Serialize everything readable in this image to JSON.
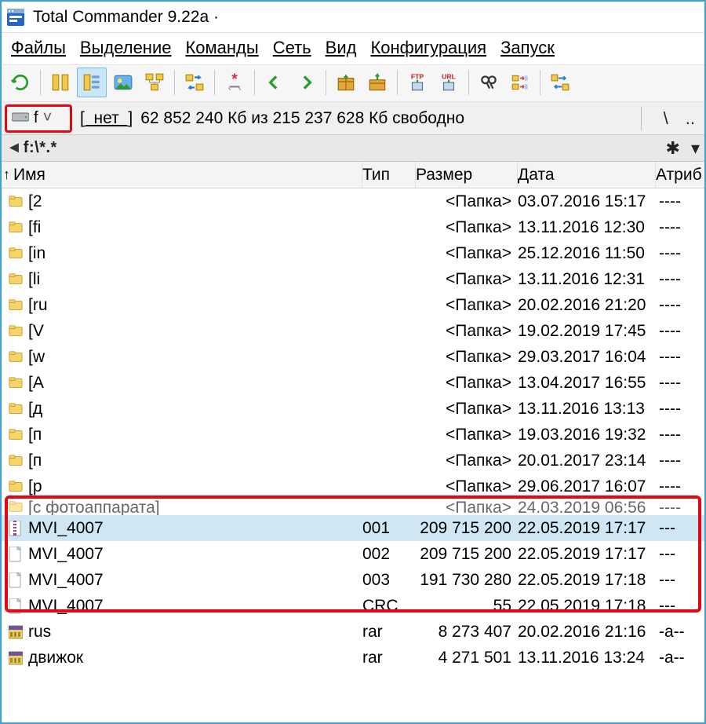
{
  "title": "Total Commander 9.22a ·",
  "menus": [
    "Файлы",
    "Выделение",
    "Команды",
    "Сеть",
    "Вид",
    "Конфигурация",
    "Запуск"
  ],
  "drive": {
    "letter": "f",
    "label": "[_нет_]",
    "free_text": "62 852 240 Кб из 215 237 628 Кб свободно",
    "right_backslash": "\\",
    "right_dots": ".."
  },
  "path": {
    "text": "f:\\",
    "star": "✱",
    "chev": "▾"
  },
  "columns": {
    "name": "Имя",
    "type": "Тип",
    "size": "Размер",
    "date": "Дата",
    "attr": "Атриб"
  },
  "rows": [
    {
      "kind": "folder",
      "name": "[2",
      "size": "<Папка>",
      "date": "03.07.2016 15:17",
      "attr": "----"
    },
    {
      "kind": "folder",
      "name": "[fi",
      "size": "<Папка>",
      "date": "13.11.2016 12:30",
      "attr": "----"
    },
    {
      "kind": "folder",
      "name": "[in",
      "size": "<Папка>",
      "date": "25.12.2016 11:50",
      "attr": "----"
    },
    {
      "kind": "folder",
      "name": "[li",
      "size": "<Папка>",
      "date": "13.11.2016 12:31",
      "attr": "----"
    },
    {
      "kind": "folder",
      "name": "[ru",
      "size": "<Папка>",
      "date": "20.02.2016 21:20",
      "attr": "----"
    },
    {
      "kind": "folder",
      "name": "[V",
      "size": "<Папка>",
      "date": "19.02.2019 17:45",
      "attr": "----"
    },
    {
      "kind": "folder",
      "name": "[w",
      "size": "<Папка>",
      "date": "29.03.2017 16:04",
      "attr": "----"
    },
    {
      "kind": "folder",
      "name": "[А",
      "size": "<Папка>",
      "date": "13.04.2017 16:55",
      "attr": "----"
    },
    {
      "kind": "folder",
      "name": "[д",
      "size": "<Папка>",
      "date": "13.11.2016 13:13",
      "attr": "----"
    },
    {
      "kind": "folder",
      "name": "[п",
      "size": "<Папка>",
      "date": "19.03.2016 19:32",
      "attr": "----"
    },
    {
      "kind": "folder",
      "name": "[п",
      "size": "<Папка>",
      "date": "20.01.2017 23:14",
      "attr": "----"
    },
    {
      "kind": "folder",
      "name": "[р",
      "size": "<Папка>",
      "date": "29.06.2017 16:07",
      "attr": "----"
    },
    {
      "kind": "folder",
      "name": "[с фотоаппарата]",
      "size": "<Папка>",
      "date": "24.03.2019 06:56",
      "attr": "----",
      "clipped": true
    },
    {
      "kind": "file",
      "icon": "archive",
      "name": "MVI_4007",
      "type": "001",
      "size": "209 715 200",
      "date": "22.05.2019 17:17",
      "attr": "---",
      "selected": true
    },
    {
      "kind": "file",
      "icon": "doc",
      "name": "MVI_4007",
      "type": "002",
      "size": "209 715 200",
      "date": "22.05.2019 17:17",
      "attr": "---"
    },
    {
      "kind": "file",
      "icon": "doc",
      "name": "MVI_4007",
      "type": "003",
      "size": "191 730 280",
      "date": "22.05.2019 17:18",
      "attr": "---"
    },
    {
      "kind": "file",
      "icon": "doc",
      "name": "MVI_4007",
      "type": "CRC",
      "size": "55",
      "date": "22.05.2019 17:18",
      "attr": "---"
    },
    {
      "kind": "file",
      "icon": "rar",
      "name": "rus",
      "type": "rar",
      "size": "8 273 407",
      "date": "20.02.2016 21:16",
      "attr": "-a--"
    },
    {
      "kind": "file",
      "icon": "rar",
      "name": "движок",
      "type": "rar",
      "size": "4 271 501",
      "date": "13.11.2016 13:24",
      "attr": "-a--"
    }
  ],
  "redbox": {
    "top_row": 12,
    "row_count": 5
  }
}
